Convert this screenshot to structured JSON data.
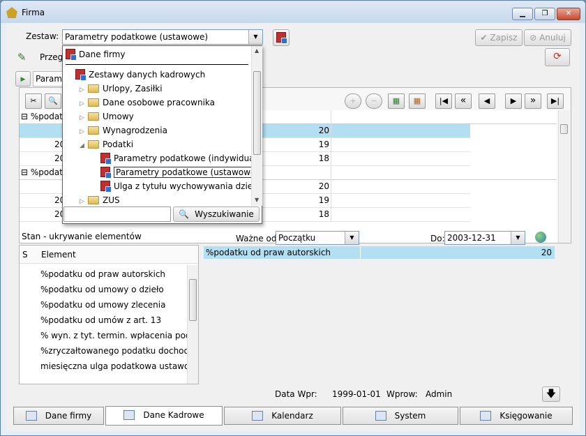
{
  "window": {
    "title": "Firma",
    "min": "▁",
    "max": "❐",
    "close": "✕"
  },
  "toolbar": {
    "zestaw_label": "Zestaw:",
    "zestaw_value": "Parametry podatkowe (ustawowe)",
    "save_label": "Zapisz",
    "cancel_label": "Anuluj",
    "przeg_label": "Przeg",
    "param_label": "Parame"
  },
  "dropdown": {
    "top_item": "Dane firmy",
    "tree": [
      {
        "label": "Zestawy danych kadrowych",
        "type": "red",
        "indent": 0,
        "toggle": ""
      },
      {
        "label": "Urlopy, Zasiłki",
        "type": "folder",
        "indent": 1,
        "toggle": "▷"
      },
      {
        "label": "Dane osobowe pracownika",
        "type": "folder",
        "indent": 1,
        "toggle": "▷"
      },
      {
        "label": "Umowy",
        "type": "folder",
        "indent": 1,
        "toggle": "▷"
      },
      {
        "label": "Wynagrodzenia",
        "type": "folder",
        "indent": 1,
        "toggle": "▷"
      },
      {
        "label": "Podatki",
        "type": "folder",
        "indent": 1,
        "toggle": "◢"
      },
      {
        "label": "Parametry podatkowe (indywidualne)",
        "type": "red",
        "indent": 2,
        "toggle": ""
      },
      {
        "label": "Parametry podatkowe (ustawowe)",
        "type": "red",
        "indent": 2,
        "toggle": "",
        "selected": true
      },
      {
        "label": "Ulga z tytułu wychowywania dziecka(PI",
        "type": "red",
        "indent": 2,
        "toggle": ""
      },
      {
        "label": "ZUS",
        "type": "folder",
        "indent": 1,
        "toggle": "▷"
      }
    ],
    "search_value": "",
    "search_button": "Wyszukiwanie"
  },
  "grid": {
    "group1": "%podatk",
    "group2": "%podat",
    "row_prefix": "20",
    "rows1": [
      "20",
      "19",
      "18"
    ],
    "rows2": [
      "20",
      "19",
      "18"
    ]
  },
  "nav": {
    "plus": "+",
    "minus": "−",
    "first": "|◀",
    "prevprev": "«",
    "prev": "◀",
    "next": "▶",
    "nextnext": "»",
    "last": "▶|"
  },
  "left_panel": {
    "title": "Stan - ukrywanie elementów",
    "col_s": "S",
    "col_element": "Element",
    "items": [
      "%podatku od praw autorskich",
      "%podatku od umowy o dzieło",
      "%podatku od umowy zlecenia",
      "%podatku od umów z art. 13",
      "% wyn. z tyt. termin. wpłacenia pod. doc",
      "%zryczałtowanego podatku dochodowe",
      "miesięczna ulga podatkowa ustawowa"
    ]
  },
  "right_panel": {
    "wazne_label": "Ważne od:",
    "wazne_value": "Początku",
    "do_label": "Do:",
    "do_value": "2003-12-31",
    "row_label": "%podatku od praw autorskich",
    "row_value": "20"
  },
  "footer": {
    "data_wpr_label": "Data Wpr:",
    "data_wpr_value": "1999-01-01",
    "wprow_label": "Wprow:",
    "wprow_value": "Admin"
  },
  "tabs": [
    "Dane firmy",
    "Dane Kadrowe",
    "Kalendarz",
    "System",
    "Księgowanie"
  ],
  "colors": {
    "selection": "#b3dff2",
    "window_frame": "#c6d8ec"
  }
}
